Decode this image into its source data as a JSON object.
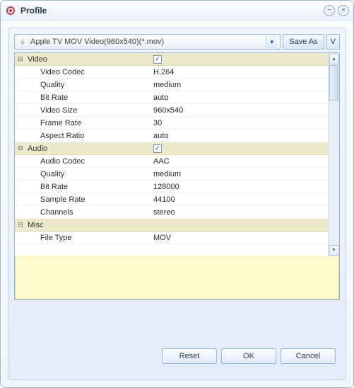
{
  "window": {
    "title": "Profile"
  },
  "toolbar": {
    "preset": "Apple TV MOV Video(960x540)(*.mov)",
    "save_as": "Save As",
    "v_btn": "V"
  },
  "sections": {
    "video": {
      "label": "Video",
      "checked": true,
      "rows": {
        "codec_label": "Video Codec",
        "codec_value": "H.264",
        "quality_label": "Quality",
        "quality_value": "medium",
        "bitrate_label": "Bit Rate",
        "bitrate_value": "auto",
        "size_label": "Video Size",
        "size_value": "960x540",
        "fps_label": "Frame Rate",
        "fps_value": "30",
        "aspect_label": "Aspect Ratio",
        "aspect_value": "auto"
      }
    },
    "audio": {
      "label": "Audio",
      "checked": true,
      "rows": {
        "codec_label": "Audio Codec",
        "codec_value": "AAC",
        "quality_label": "Quality",
        "quality_value": "medium",
        "bitrate_label": "Bit Rate",
        "bitrate_value": "128000",
        "sample_label": "Sample Rate",
        "sample_value": "44100",
        "channels_label": "Channels",
        "channels_value": "stereo"
      }
    },
    "misc": {
      "label": "Misc",
      "rows": {
        "filetype_label": "File Type",
        "filetype_value": "MOV"
      }
    }
  },
  "footer": {
    "reset": "Reset",
    "ok": "OK",
    "cancel": "Cancel"
  }
}
